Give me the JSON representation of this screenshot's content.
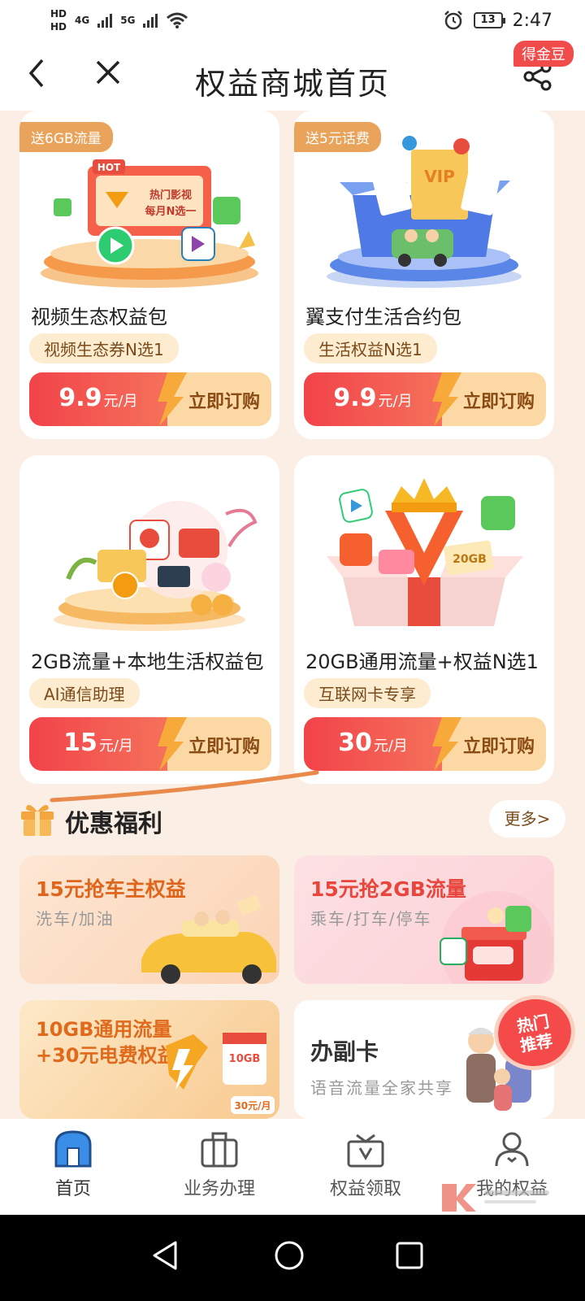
{
  "status_bar": {
    "hd1": "HD",
    "hd2": "HD",
    "net1": "4G",
    "net2": "5G",
    "battery": "13",
    "time": "2:47"
  },
  "header": {
    "title": "权益商城首页",
    "coin_badge": "得金豆"
  },
  "products": [
    {
      "tag": "送6GB流量",
      "title": "视频生态权益包",
      "chip": "视频生态券N选1",
      "price": "9.9",
      "unit": "元/月",
      "buy_label": "立即订购"
    },
    {
      "tag": "送5元话费",
      "title": "翼支付生活合约包",
      "chip": "生活权益N选1",
      "price": "9.9",
      "unit": "元/月",
      "buy_label": "立即订购"
    },
    {
      "tag": "",
      "title": "2GB流量+本地生活权益包",
      "chip": "AI通信助理",
      "price": "15",
      "unit": "元/月",
      "buy_label": "立即订购"
    },
    {
      "tag": "",
      "title": "20GB通用流量+权益N选1",
      "chip": "互联网卡专享",
      "price": "30",
      "unit": "元/月",
      "buy_label": "立即订购"
    }
  ],
  "art_text": {
    "hot": "HOT",
    "video_line1": "热门影视",
    "video_line2": "每月N选一",
    "vip": "VIP",
    "gb20": "20GB"
  },
  "welfare": {
    "title": "优惠福利",
    "more": "更多>",
    "tiles": [
      {
        "title": "15元抢车主权益",
        "sub": "洗车/加油"
      },
      {
        "title": "15元抢2GB流量",
        "sub": "乘车/打车/停车"
      },
      {
        "title_line1": "10GB通用流量",
        "title_line2": "+30元电费权益",
        "box_label": "10GB",
        "price_tag": "30元/月"
      },
      {
        "title": "办副卡",
        "sub": "语音流量全家共享"
      }
    ],
    "hot_badge_line1": "热门",
    "hot_badge_line2": "推荐"
  },
  "bottom_nav": [
    {
      "label": "首页",
      "icon": "home-icon",
      "active": true
    },
    {
      "label": "业务办理",
      "icon": "briefcase-icon",
      "active": false
    },
    {
      "label": "权益领取",
      "icon": "gift-box-icon",
      "active": false
    },
    {
      "label": "我的权益",
      "icon": "user-icon",
      "active": false
    }
  ],
  "colors": {
    "accent_red": "#f2434a",
    "accent_gold": "#fcd9a4",
    "tag_orange": "#e9a35a",
    "page_bg": "#fbeee4"
  }
}
